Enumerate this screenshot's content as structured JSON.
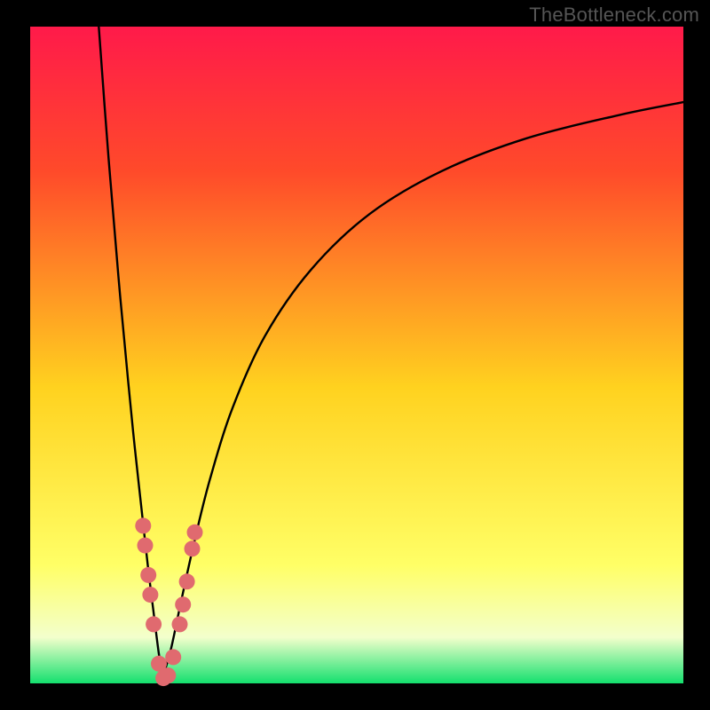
{
  "watermark": "TheBottleneck.com",
  "colors": {
    "frame": "#000000",
    "curve": "#000000",
    "dot_fill": "#e06a6f",
    "dot_stroke": "#b9474d",
    "grad_top": "#ff1a4a",
    "grad_upper": "#ff4a2a",
    "grad_mid": "#ffd21f",
    "grad_low": "#ffff66",
    "grad_pale": "#f3ffcc",
    "grad_bottom": "#14e06e"
  },
  "chart_data": {
    "type": "line",
    "title": "",
    "xlabel": "",
    "ylabel": "",
    "xlim": [
      0,
      100
    ],
    "ylim": [
      0,
      100
    ],
    "grid": false,
    "note": "Bottleneck-style V-curve. x is a normalized component ratio (0–100); y is mismatch percentage (0 = perfectly balanced at bottom, 100 = maximal bottleneck at top). Axes are unlabeled in the image; all values are estimated from pixel positions.",
    "series": [
      {
        "name": "left-branch",
        "x": [
          10.5,
          12.0,
          13.5,
          15.0,
          16.0,
          17.0,
          18.0,
          19.0,
          19.7,
          20.3
        ],
        "y": [
          100.0,
          80.0,
          62.0,
          46.0,
          36.0,
          27.0,
          18.0,
          10.0,
          4.5,
          1.0
        ]
      },
      {
        "name": "right-branch",
        "x": [
          20.3,
          21.5,
          23.0,
          25.0,
          27.5,
          31.0,
          36.0,
          43.0,
          52.0,
          63.0,
          76.0,
          90.0,
          100.0
        ],
        "y": [
          1.0,
          5.0,
          12.0,
          21.0,
          31.0,
          42.0,
          53.0,
          63.0,
          71.5,
          78.0,
          83.0,
          86.5,
          88.5
        ]
      }
    ],
    "points": [
      {
        "name": "sample-dot",
        "x": 17.3,
        "y": 24.0
      },
      {
        "name": "sample-dot",
        "x": 17.6,
        "y": 21.0
      },
      {
        "name": "sample-dot",
        "x": 18.1,
        "y": 16.5
      },
      {
        "name": "sample-dot",
        "x": 18.4,
        "y": 13.5
      },
      {
        "name": "sample-dot",
        "x": 18.9,
        "y": 9.0
      },
      {
        "name": "sample-dot",
        "x": 19.7,
        "y": 3.0
      },
      {
        "name": "sample-dot",
        "x": 20.4,
        "y": 0.8
      },
      {
        "name": "sample-dot",
        "x": 21.1,
        "y": 1.2
      },
      {
        "name": "sample-dot",
        "x": 21.9,
        "y": 4.0
      },
      {
        "name": "sample-dot",
        "x": 22.9,
        "y": 9.0
      },
      {
        "name": "sample-dot",
        "x": 23.4,
        "y": 12.0
      },
      {
        "name": "sample-dot",
        "x": 24.0,
        "y": 15.5
      },
      {
        "name": "sample-dot",
        "x": 24.8,
        "y": 20.5
      },
      {
        "name": "sample-dot",
        "x": 25.2,
        "y": 23.0
      }
    ]
  }
}
